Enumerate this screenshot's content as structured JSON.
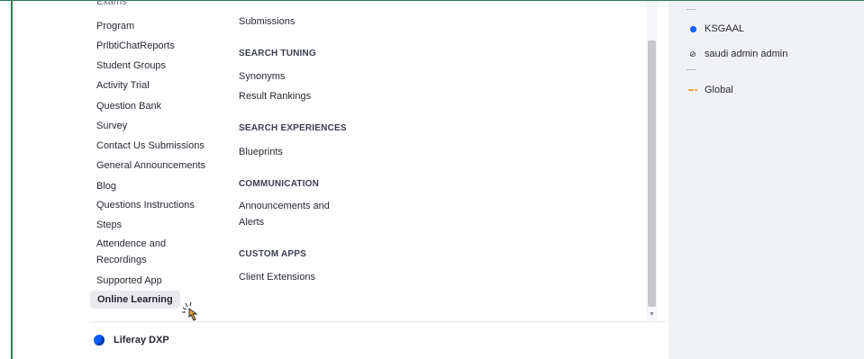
{
  "menu": {
    "column1": {
      "clipped_item": "Exams",
      "items": [
        "Program",
        "PrlbtiChatReports",
        "Student Groups",
        "Activity Trial",
        "Question Bank",
        "Survey",
        "Contact Us Submissions",
        "General Announcements",
        "Blog",
        "Questions Instructions",
        "Steps",
        "Attendence and Recordings",
        "Supported App"
      ],
      "selected_item": "Online Learning"
    },
    "column2": {
      "top_item": "Submissions",
      "sections": [
        {
          "heading": "SEARCH TUNING",
          "items": [
            "Synonyms",
            "Result Rankings"
          ]
        },
        {
          "heading": "SEARCH EXPERIENCES",
          "items": [
            "Blueprints"
          ]
        },
        {
          "heading": "COMMUNICATION",
          "items": [
            "Announcements and Alerts"
          ]
        },
        {
          "heading": "CUSTOM APPS",
          "items": [
            "Client Extensions"
          ]
        }
      ]
    }
  },
  "footer": {
    "brand_label": "Liferay DXP",
    "brand_icon": "liferay-logo-icon",
    "brand_color": "#0b5fff"
  },
  "sites": [
    {
      "label": "KSGAAL",
      "icon": "site-dot-icon"
    },
    {
      "label": "saudi admin admin",
      "icon": "globe-icon"
    },
    {
      "label": "Global",
      "icon": "global-icon"
    }
  ],
  "colors": {
    "frame": "#2e7d57",
    "accent": "#0b5fff",
    "right_pane": "#f1f2f5"
  }
}
